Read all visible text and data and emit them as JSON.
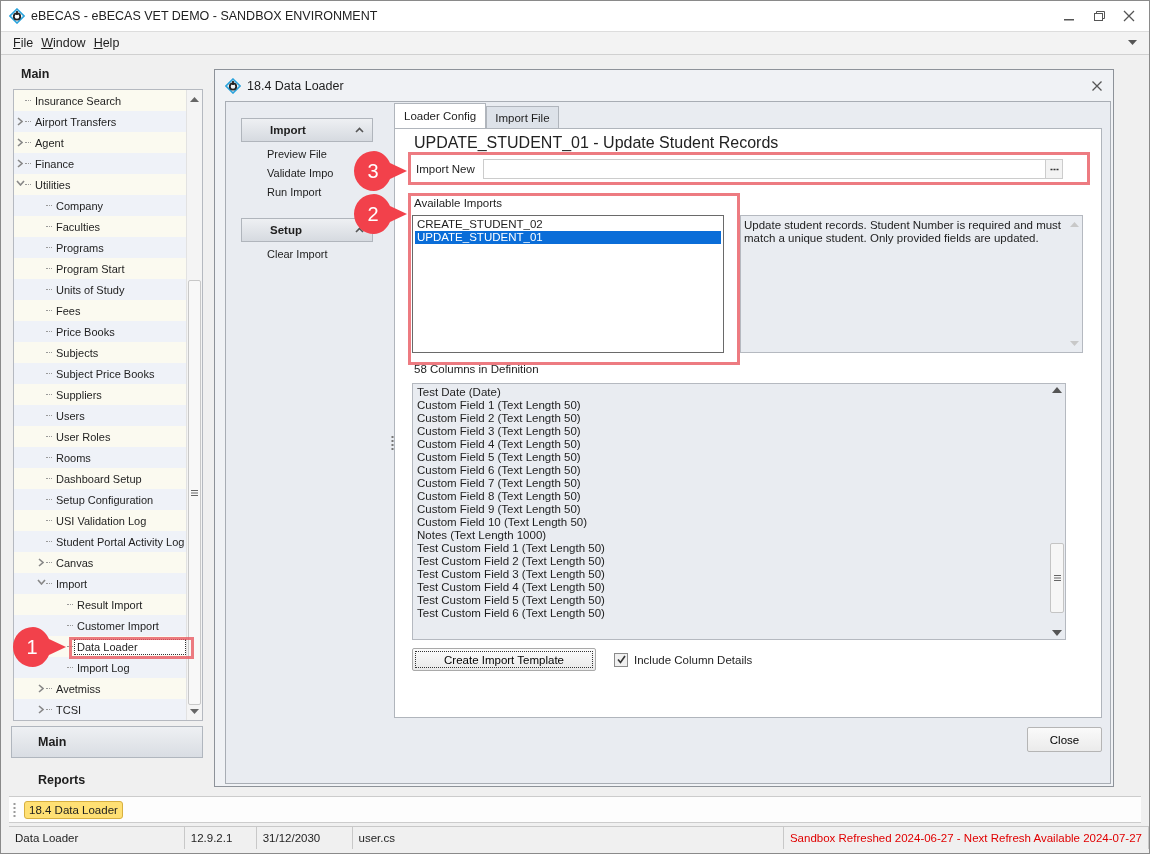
{
  "window": {
    "title": "eBECAS - eBECAS VET DEMO - SANDBOX ENVIRONMENT"
  },
  "menu": [
    {
      "label": "File"
    },
    {
      "label": "Window"
    },
    {
      "label": "Help"
    }
  ],
  "sidebar": {
    "title": "Main",
    "tree": [
      {
        "label": "Insurance Search",
        "selected": false
      },
      {
        "label": "Airport Transfers",
        "expanded": false,
        "selected": false
      },
      {
        "label": "Agent",
        "expanded": false,
        "selected": false
      },
      {
        "label": "Finance",
        "expanded": false,
        "selected": false
      },
      {
        "label": "Utilities",
        "expanded": true,
        "selected": false,
        "children": [
          {
            "label": "Company",
            "selected": false
          },
          {
            "label": "Faculties",
            "selected": false
          },
          {
            "label": "Programs",
            "selected": false
          },
          {
            "label": "Program Start",
            "selected": false
          },
          {
            "label": "Units of Study",
            "selected": false
          },
          {
            "label": "Fees",
            "selected": false
          },
          {
            "label": "Price Books",
            "selected": false
          },
          {
            "label": "Subjects",
            "selected": false
          },
          {
            "label": "Subject Price Books",
            "selected": false
          },
          {
            "label": "Suppliers",
            "selected": false
          },
          {
            "label": "Users",
            "selected": false
          },
          {
            "label": "User Roles",
            "selected": false
          },
          {
            "label": "Rooms",
            "selected": false
          },
          {
            "label": "Dashboard Setup",
            "selected": false
          },
          {
            "label": "Setup Configuration",
            "selected": false
          },
          {
            "label": "USI Validation Log",
            "selected": false
          },
          {
            "label": "Student Portal Activity Log",
            "selected": false
          },
          {
            "label": "Canvas",
            "expanded": false,
            "selected": false
          },
          {
            "label": "Import",
            "expanded": true,
            "selected": false,
            "children": [
              {
                "label": "Result Import",
                "selected": false
              },
              {
                "label": "Customer Import",
                "selected": false
              },
              {
                "label": "Data Loader",
                "selected": true
              },
              {
                "label": "Import Log",
                "selected": false
              }
            ]
          },
          {
            "label": "Avetmiss",
            "expanded": false,
            "selected": false
          },
          {
            "label": "TCSI",
            "expanded": false,
            "selected": false
          }
        ]
      }
    ],
    "nav_buttons": [
      {
        "label": "Main",
        "selected": true
      },
      {
        "label": "Reports",
        "selected": false
      }
    ]
  },
  "child_window": {
    "title": "18.4 Data Loader",
    "nav_groups": [
      {
        "title": "Import",
        "expanded": true,
        "items": [
          "Preview File",
          "Validate Impo",
          "Run Import"
        ]
      },
      {
        "title": "Setup",
        "expanded": true,
        "items": [
          "Clear Import"
        ]
      }
    ],
    "tabs": [
      {
        "label": "Loader Config",
        "selected": true
      },
      {
        "label": "Import File",
        "selected": false
      }
    ],
    "heading": "UPDATE_STUDENT_01 - Update Student Records",
    "import_new": {
      "label": "Import New"
    },
    "available_imports": {
      "label": "Available Imports",
      "items": [
        {
          "label": "CREATE_STUDENT_02",
          "selected": false
        },
        {
          "label": "UPDATE_STUDENT_01",
          "selected": true
        }
      ]
    },
    "description": "Update student records. Student Number is required and must match a unique student. Only provided fields are updated.",
    "columns": {
      "label": "58 Columns in Definition",
      "items": [
        "Test Date (Date)",
        "Custom Field 1 (Text Length 50)",
        "Custom Field 2 (Text Length 50)",
        "Custom Field 3 (Text Length 50)",
        "Custom Field 4 (Text Length 50)",
        "Custom Field 5 (Text Length 50)",
        "Custom Field 6 (Text Length 50)",
        "Custom Field 7 (Text Length 50)",
        "Custom Field 8 (Text Length 50)",
        "Custom Field 9 (Text Length 50)",
        "Custom Field 10 (Text Length 50)",
        "Notes (Text Length 1000)",
        "Test Custom Field 1 (Text Length 50)",
        "Test Custom Field 2 (Text Length 50)",
        "Test Custom Field 3 (Text Length 50)",
        "Test Custom Field 4 (Text Length 50)",
        "Test Custom Field 5 (Text Length 50)",
        "Test Custom Field 6 (Text Length 50)"
      ]
    },
    "template_button": "Create Import Template",
    "include_details": {
      "label": "Include Column Details",
      "checked": true
    },
    "close_button": "Close"
  },
  "taskbar": [
    {
      "label": "18.4 Data Loader",
      "selected": true
    }
  ],
  "status_bar": [
    {
      "text": "Data Loader",
      "kind": "normal"
    },
    {
      "text": "12.9.2.1",
      "kind": "normal"
    },
    {
      "text": "31/12/2030",
      "kind": "normal"
    },
    {
      "text": "user.cs",
      "kind": "normal"
    },
    {
      "text": "Sandbox Refreshed 2024-06-27 - Next Refresh Available 2024-07-27",
      "kind": "alert"
    }
  ],
  "annotations": [
    {
      "number": "1"
    },
    {
      "number": "2"
    },
    {
      "number": "3"
    }
  ]
}
